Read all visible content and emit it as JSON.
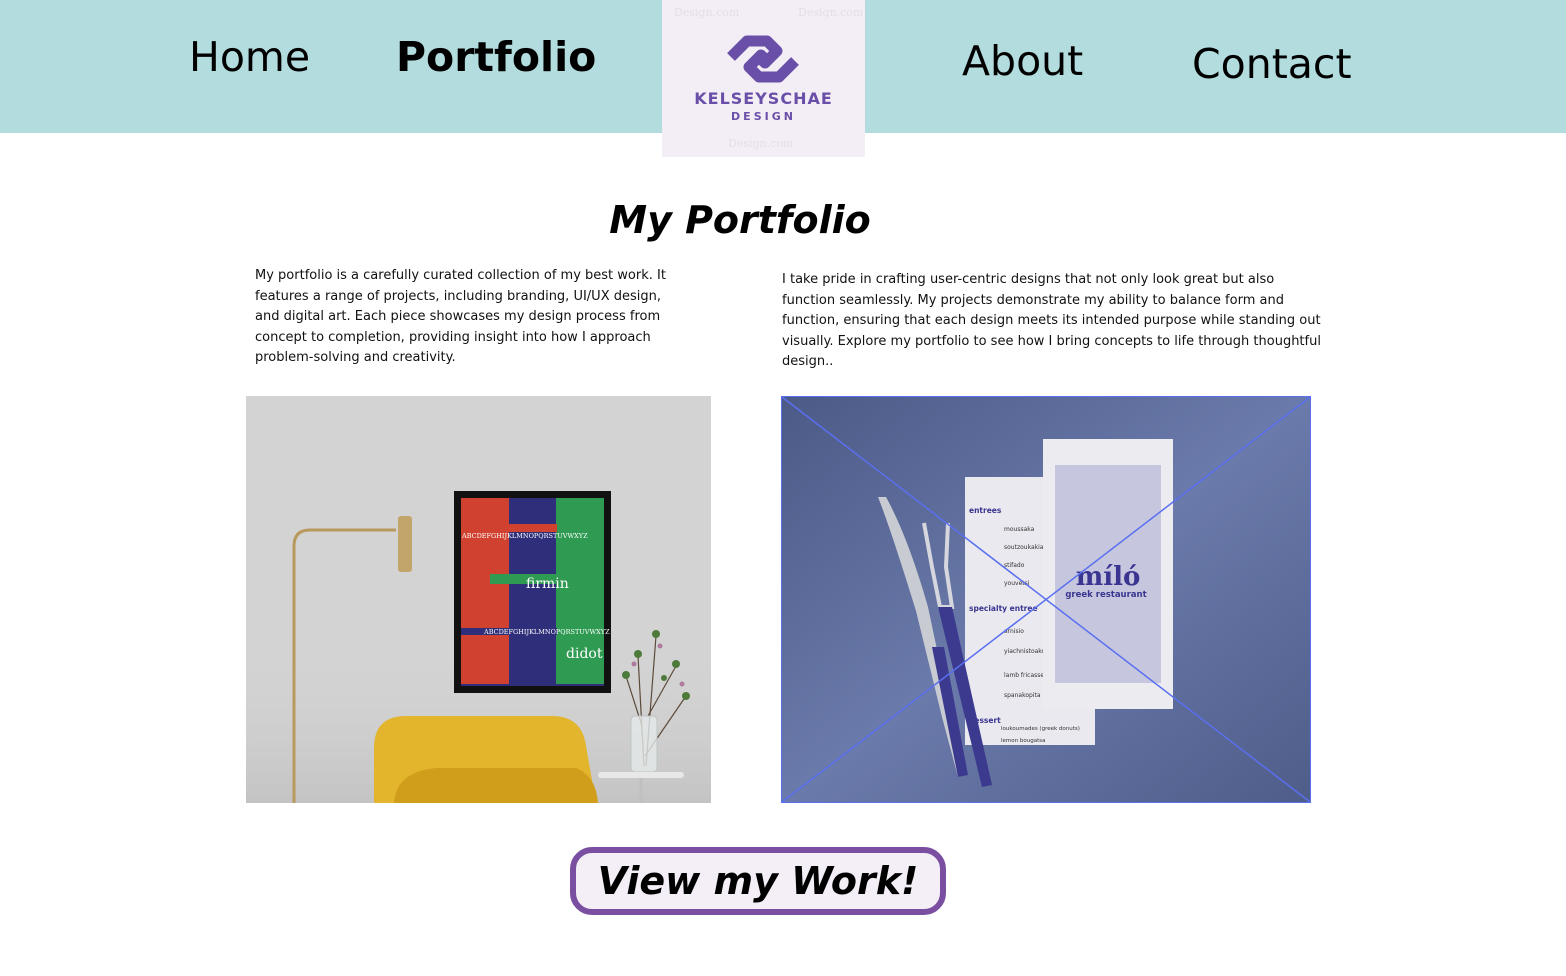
{
  "nav": {
    "home": "Home",
    "portfolio": "Portfolio",
    "about": "About",
    "contact": "Contact"
  },
  "logo": {
    "name": "KELSEYSCHAE",
    "sub": "DESIGN",
    "watermark": "Design.com"
  },
  "main": {
    "title": "My Portfolio",
    "intro_left": "My portfolio is a carefully curated collection of my best work. It features a range of projects, including branding, UI/UX design, and digital art. Each piece showcases my design process from concept to completion, providing insight into how I approach problem-solving and creativity.",
    "intro_right": "I take pride in crafting user-centric designs that not only look great but also function seamlessly. My projects demonstrate my ability to balance form and function, ensuring that each design meets its intended purpose while standing out visually. Explore my portfolio to see how I bring concepts to life through thoughtful design.."
  },
  "poster": {
    "alphabet": "ABCDEFGHIJKLMNOPQRSTUVWXYZ",
    "word1": "firmin",
    "word2": "didot"
  },
  "menu": {
    "brand": "míló",
    "brand_sub": "greek restaurant",
    "entrees": "entrees",
    "specialty": "specialty entree",
    "dessert": "dessert",
    "items": [
      "moussaka",
      "soutzoukakia",
      "stifado",
      "youvetsi",
      "arnisio",
      "yiachnistoakopita",
      "lamb fricassee",
      "spanakopita",
      "loukoumades (greek donuts)",
      "lemon bougatsa"
    ]
  },
  "cta": {
    "label": "View my Work!"
  },
  "colors": {
    "nav_bg": "#b2dcdd",
    "logo_purple": "#6a4fa8",
    "cta_border": "#7a4ea0",
    "menu_photo_bg": "#5d6d9c"
  }
}
